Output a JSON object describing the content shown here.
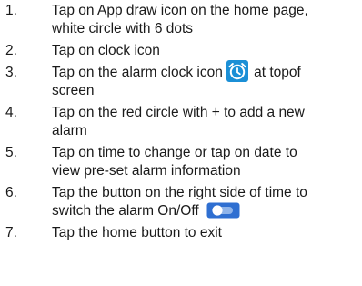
{
  "steps": [
    {
      "num": "1.",
      "lines": [
        "Tap on App draw icon on the home page,",
        "white circle with 6 dots"
      ]
    },
    {
      "num": "2.",
      "lines": [
        "Tap on clock icon"
      ]
    },
    {
      "num": "3.",
      "lines": [
        "Tap on the alarm clock icon",
        "at topof",
        "screen"
      ]
    },
    {
      "num": "4.",
      "lines": [
        "Tap on the red circle with + to add a new",
        "alarm"
      ]
    },
    {
      "num": "5.",
      "lines": [
        "Tap on time to change or tap on date to",
        "view pre-set alarm information"
      ]
    },
    {
      "num": "6.",
      "lines": [
        "Tap the button on the right side of time to",
        "switch the alarm On/Off"
      ]
    },
    {
      "num": "7.",
      "lines": [
        "Tap the home button to exit"
      ]
    }
  ],
  "icons": {
    "alarm_clock": {
      "name": "alarm-clock-icon",
      "color": "#1b8fd6"
    },
    "toggle": {
      "name": "toggle-switch-icon",
      "track_color": "#2f6fd1",
      "knob_color": "#ffffff"
    }
  }
}
